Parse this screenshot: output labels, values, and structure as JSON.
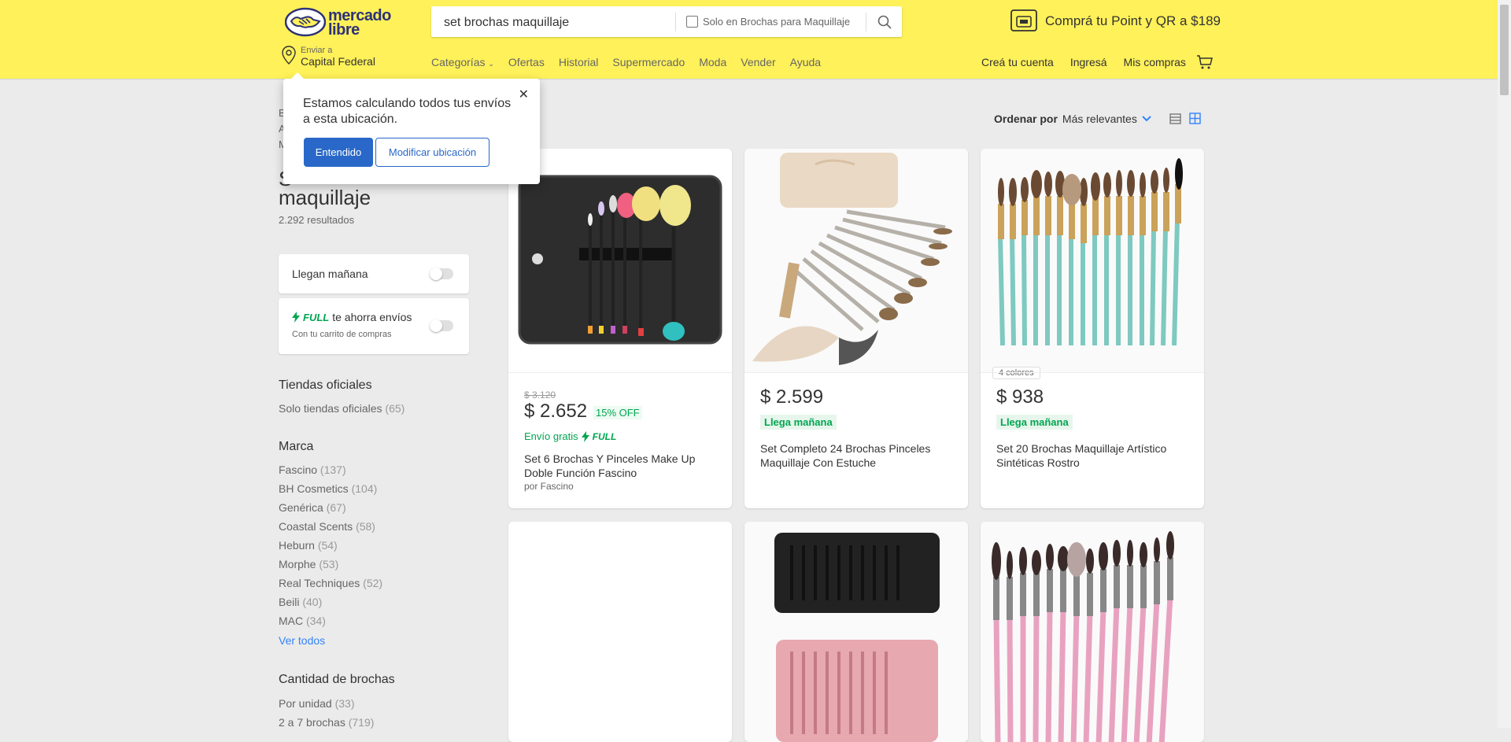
{
  "header": {
    "logo_text_1": "mercado",
    "logo_text_2": "libre",
    "search_value": "set brochas maquillaje",
    "search_checkbox_label": "Solo en Brochas para Maquillaje",
    "promo": "Comprá tu Point y QR a $189",
    "location_small": "Enviar a",
    "location_big": "Capital Federal",
    "nav": [
      "Categorías",
      "Ofertas",
      "Historial",
      "Supermercado",
      "Moda",
      "Vender",
      "Ayuda"
    ],
    "right_nav": [
      "Creá tu cuenta",
      "Ingresá",
      "Mis compras"
    ]
  },
  "popup": {
    "text": "Estamos calculando todos tus envíos a esta ubicación.",
    "primary": "Entendido",
    "secondary": "Modificar ubicación"
  },
  "sidebar": {
    "breadcrumb_bits": [
      "B",
      "A",
      "M"
    ],
    "title_first": "S",
    "title_second": "maquillaje",
    "results": "2.292 resultados",
    "filter1": "Llegan mañana",
    "filter2_full": "FULL",
    "filter2_text": "te ahorra envíos",
    "filter2_sub": "Con tu carrito de compras",
    "tiendas_title": "Tiendas oficiales",
    "tiendas_item": "Solo tiendas oficiales",
    "tiendas_count": "(65)",
    "marca_title": "Marca",
    "marcas": [
      {
        "name": "Fascino",
        "count": "(137)"
      },
      {
        "name": "BH Cosmetics",
        "count": "(104)"
      },
      {
        "name": "Genérica",
        "count": "(67)"
      },
      {
        "name": "Coastal Scents",
        "count": "(58)"
      },
      {
        "name": "Heburn",
        "count": "(54)"
      },
      {
        "name": "Morphe",
        "count": "(53)"
      },
      {
        "name": "Real Techniques",
        "count": "(52)"
      },
      {
        "name": "Beili",
        "count": "(40)"
      },
      {
        "name": "MAC",
        "count": "(34)"
      }
    ],
    "ver_todos": "Ver todos",
    "cantidad_title": "Cantidad de brochas",
    "cantidad": [
      {
        "name": "Por unidad",
        "count": "(33)"
      },
      {
        "name": "2 a 7 brochas",
        "count": "(719)"
      }
    ]
  },
  "sort": {
    "label": "Ordenar por",
    "value": "Más relevantes"
  },
  "products": [
    {
      "old_price": "$ 3.120",
      "price": "$ 2.652",
      "off": "15% OFF",
      "envio": "Envío gratis",
      "full": "FULL",
      "title": "Set 6 Brochas Y Pinceles Make Up Doble Función Fascino",
      "seller": "por Fascino"
    },
    {
      "price": "$ 2.599",
      "llega": "Llega mañana",
      "title": "Set Completo 24 Brochas Pinceles Maquillaje Con Estuche"
    },
    {
      "colores": "4 colores",
      "price": "$ 938",
      "llega": "Llega mañana",
      "title": "Set 20 Brochas Maquillaje Artístico Sintéticas Rostro"
    }
  ],
  "colors": {
    "header_yellow": "#fff159",
    "blue": "#3483fa",
    "green": "#00a650"
  }
}
